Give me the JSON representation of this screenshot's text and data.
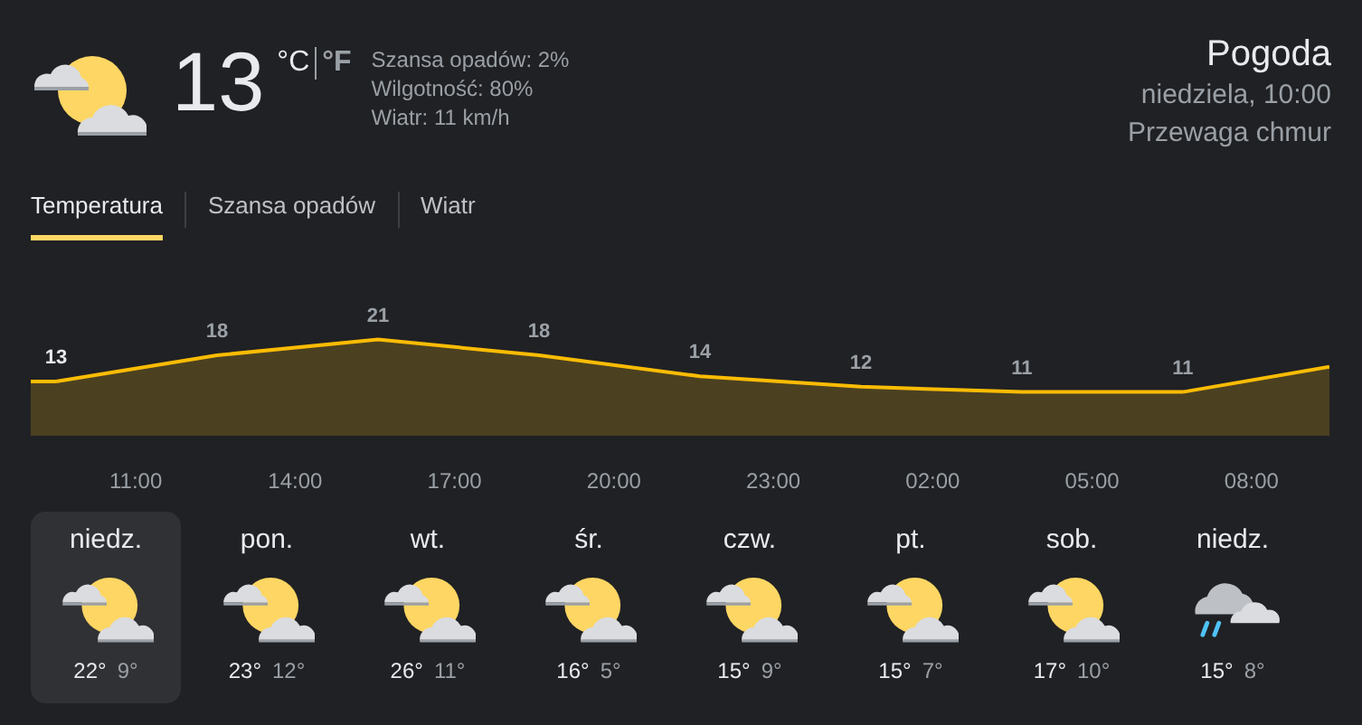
{
  "current": {
    "kind": "partly_cloudy",
    "temperature": "13",
    "units": [
      {
        "label": "°C",
        "selected": true
      },
      {
        "label": "°F",
        "selected": false
      }
    ],
    "details": [
      "Szansa opadów: 2%",
      "Wilgotność: 80%",
      "Wiatr: 11 km/h"
    ]
  },
  "header": {
    "title": "Pogoda",
    "datetime": "niedziela, 10:00",
    "condition": "Przewaga chmur"
  },
  "tabs": [
    {
      "label": "Temperatura",
      "selected": true
    },
    {
      "label": "Szansa opadów",
      "selected": false
    },
    {
      "label": "Wiatr",
      "selected": false
    }
  ],
  "chart_data": {
    "type": "area",
    "categories": [
      null,
      null,
      null,
      null,
      null,
      null,
      null,
      null
    ],
    "series": [
      {
        "color": "#fbbc04",
        "values": [
          13,
          18,
          21,
          18,
          14,
          12,
          11,
          11
        ]
      }
    ],
    "data_labels": true
  },
  "hour_labels": [
    "11:00",
    "14:00",
    "17:00",
    "20:00",
    "23:00",
    "02:00",
    "05:00",
    "08:00"
  ],
  "days": [
    {
      "day": "niedz.",
      "kind": "partly_cloudy",
      "high": "22°",
      "low": "9°",
      "selected": true
    },
    {
      "day": "pon.",
      "kind": "partly_cloudy",
      "high": "23°",
      "low": "12°",
      "selected": false
    },
    {
      "day": "wt.",
      "kind": "partly_cloudy",
      "high": "26°",
      "low": "11°",
      "selected": false
    },
    {
      "day": "śr.",
      "kind": "partly_cloudy",
      "high": "16°",
      "low": "5°",
      "selected": false
    },
    {
      "day": "czw.",
      "kind": "partly_cloudy",
      "high": "15°",
      "low": "9°",
      "selected": false
    },
    {
      "day": "pt.",
      "kind": "partly_cloudy",
      "high": "15°",
      "low": "7°",
      "selected": false
    },
    {
      "day": "sob.",
      "kind": "partly_cloudy",
      "high": "17°",
      "low": "10°",
      "selected": false
    },
    {
      "day": "niedz.",
      "kind": "rain",
      "high": "15°",
      "low": "8°",
      "selected": false
    }
  ]
}
